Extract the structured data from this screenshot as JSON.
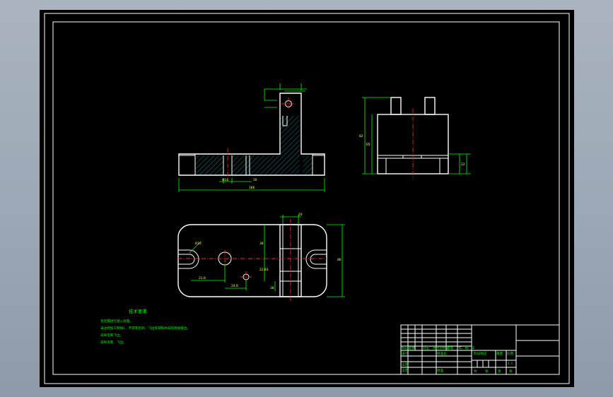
{
  "dimensions": {
    "front_width_total": "186",
    "front_hole": "Φ14",
    "front_small": "30",
    "side_height_total": "82",
    "side_height_main": "65",
    "side_bottom": "22",
    "plan_height": "86",
    "plan_left_offset": "21.8",
    "plan_hole_offset": "24.8",
    "plan_slot_radius": "R10",
    "plan_mid_height": "38",
    "plan_mid_small": "22.83",
    "plan_right_small": "20",
    "plan_bottom_small": "38"
  },
  "notes": {
    "title": "技术要求",
    "lines": [
      "毛坯需进行退火处理。",
      "未注明加工倒角1，不得有毛刺、飞边等缺陷并去除锐角锐边。",
      "去除毛刺飞边。",
      "去除毛刺、飞边。"
    ]
  },
  "title_block": {
    "row_labels": [
      "标记",
      "处数",
      "分区",
      "更改文件号",
      "签名",
      "年、月、日"
    ],
    "design_label": "设计",
    "standard_label": "标准化",
    "stage_label": "阶段标记",
    "weight_label": "重量",
    "scale_label": "比例",
    "scale_value": "1:1",
    "process_label": "工艺",
    "approve_label": "批准",
    "sheet_labels": [
      "共",
      "张",
      "第",
      "张"
    ]
  }
}
